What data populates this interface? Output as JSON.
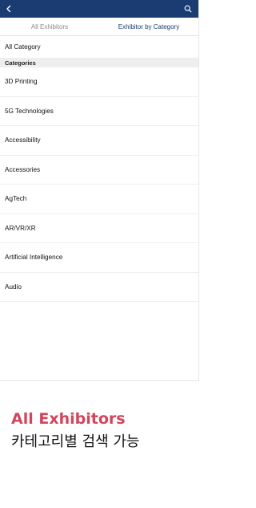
{
  "header": {
    "back_icon": "chevron-left-icon",
    "search_icon": "search-icon",
    "bar_color": "#1b3c73"
  },
  "tabs": [
    {
      "label": "All Exhibitors",
      "active": false
    },
    {
      "label": "Exhibitor by Category",
      "active": true
    }
  ],
  "all_category_label": "All Category",
  "section_header": "Categories",
  "categories": [
    "3D Printing",
    "5G Technologies",
    "Accessibility",
    "Accessories",
    "AgTech",
    "AR/VR/XR",
    "Artificial Intelligence",
    "Audio"
  ],
  "caption": {
    "title": "All Exhibitors",
    "subtitle": "카테고리별 검색 가능",
    "title_color": "#d2455d"
  }
}
